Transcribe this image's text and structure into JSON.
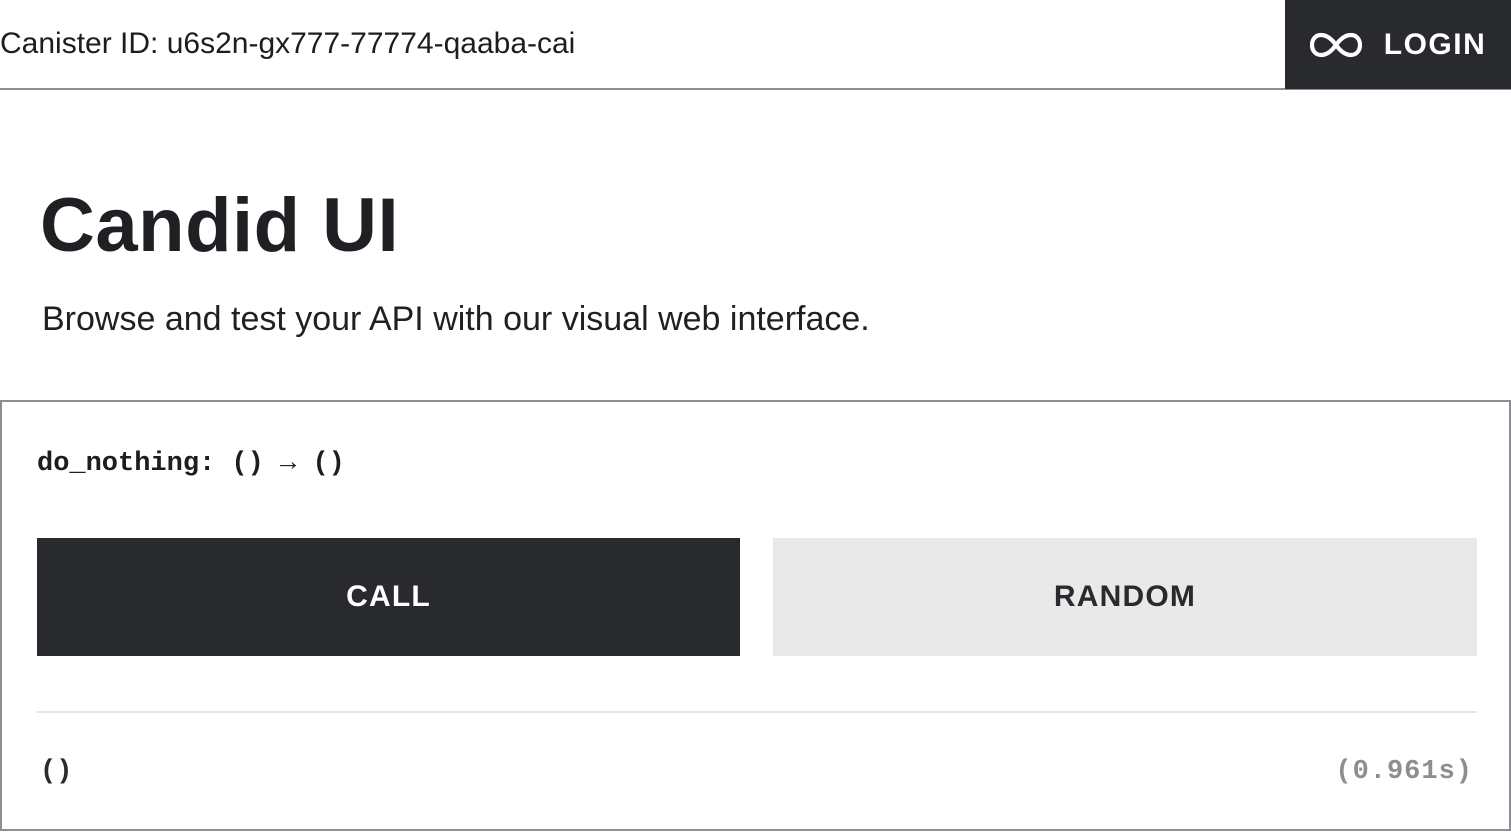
{
  "header": {
    "canister_label": "Canister ID: u6s2n-gx777-77774-qaaba-cai",
    "login_label": "LOGIN",
    "login_icon": "infinity-icon"
  },
  "hero": {
    "title": "Candid UI",
    "subtitle": "Browse and test your API with our visual web interface."
  },
  "method": {
    "signature": "do_nothing: () → ()",
    "call_label": "CALL",
    "random_label": "RANDOM",
    "result": "()",
    "duration": "(0.961s)"
  },
  "colors": {
    "dark": "#292a2e",
    "light_button": "#e9e9e9",
    "border": "#8e8e92",
    "muted_text": "#8e8e92"
  }
}
